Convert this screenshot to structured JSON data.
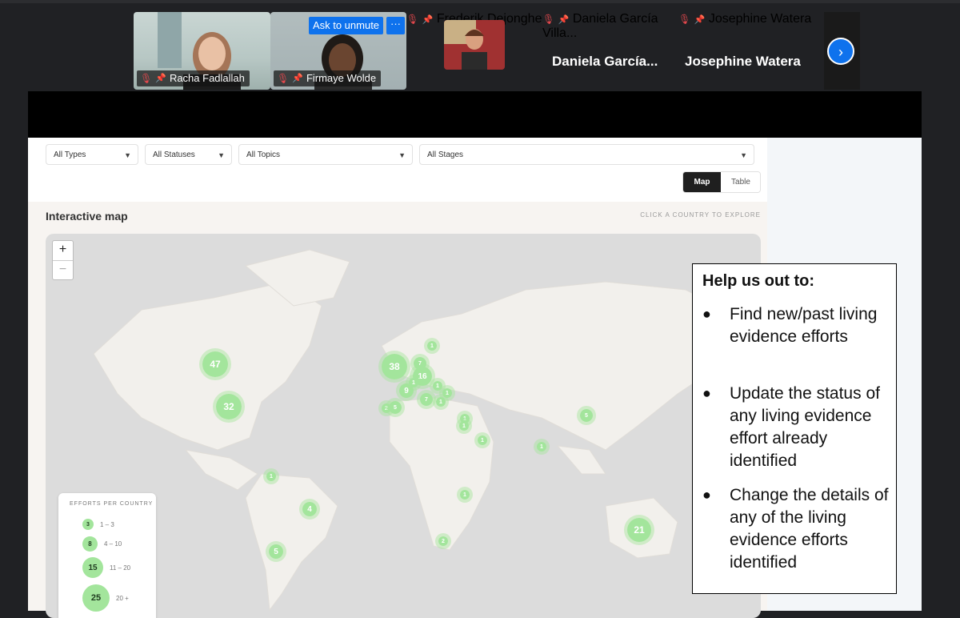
{
  "participants": [
    {
      "name": "Racha Fadlallah"
    },
    {
      "name": "Firmaye Wolde"
    },
    {
      "name": "Frederik Dejonghe"
    },
    {
      "name": "Daniela García Villa...",
      "display_name": "Daniela  García..."
    },
    {
      "name": "Josephine Watera",
      "display_name": "Josephine Watera"
    }
  ],
  "meeting": {
    "ask_to_unmute": "Ask to unmute",
    "more": "···",
    "next_arrow": "›"
  },
  "filters": {
    "types": "All Types",
    "statuses": "All Statuses",
    "topics": "All Topics",
    "stages": "All Stages"
  },
  "view_toggle": {
    "map": "Map",
    "table": "Table",
    "active": "Map"
  },
  "map_section": {
    "title": "Interactive map",
    "hint": "CLICK A COUNTRY TO EXPLORE",
    "zoom_in": "+",
    "zoom_out": "−"
  },
  "clusters": [
    {
      "count": "47"
    },
    {
      "count": "32"
    },
    {
      "count": "38"
    },
    {
      "count": "16"
    },
    {
      "count": "9"
    },
    {
      "count": "7"
    },
    {
      "count": "7"
    },
    {
      "count": "1"
    },
    {
      "count": "1"
    },
    {
      "count": "1"
    },
    {
      "count": "1"
    },
    {
      "count": "2"
    },
    {
      "count": "5"
    },
    {
      "count": "1"
    },
    {
      "count": "1"
    },
    {
      "count": "1"
    },
    {
      "count": "1"
    },
    {
      "count": "5"
    },
    {
      "count": "1"
    },
    {
      "count": "1"
    },
    {
      "count": "4"
    },
    {
      "count": "5"
    },
    {
      "count": "2"
    },
    {
      "count": "21"
    },
    {
      "count": "1"
    }
  ],
  "legend": {
    "title": "EFFORTS PER COUNTRY",
    "rows": [
      {
        "dot": "3",
        "range": "1 – 3"
      },
      {
        "dot": "8",
        "range": "4 – 10"
      },
      {
        "dot": "15",
        "range": "11 – 20"
      },
      {
        "dot": "25",
        "range": "20 +"
      }
    ]
  },
  "overlay": {
    "title": "Help us out to:",
    "bullet": "●",
    "items": [
      "Find new/past living evidence efforts",
      "Update the status of any living evidence effort already identified",
      "Change the details of any of the living evidence efforts identified"
    ]
  },
  "colors": {
    "cluster": "#a3e59c",
    "zoom_blue": "#0e72ed",
    "mic_muted": "#e5484d"
  }
}
